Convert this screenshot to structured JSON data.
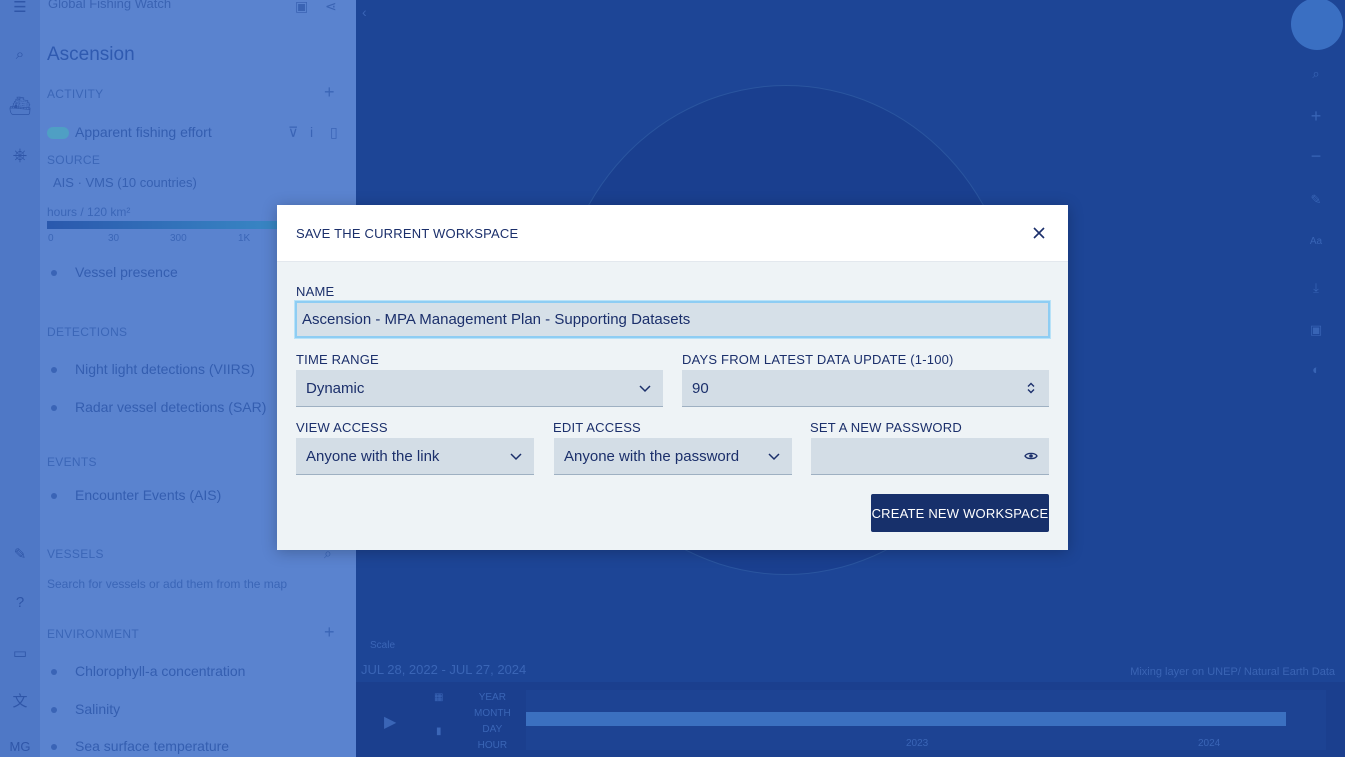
{
  "sidebar": {
    "app_name": "Global Fishing Watch",
    "app_tagline": "",
    "workspace_title": "Ascension",
    "activity": {
      "heading": "ACTIVITY",
      "layer1": "Apparent fishing effort",
      "source_heading": "SOURCE",
      "sources": "AIS · VMS (10 countries)",
      "units": "hours / 120 km²",
      "scale_ticks": [
        "0",
        "30",
        "300",
        "1K"
      ],
      "layer2": "Vessel presence"
    },
    "detections": {
      "heading": "DETECTIONS",
      "layer1": "Night light detections (VIIRS)",
      "layer2": "Radar vessel detections (SAR)"
    },
    "events": {
      "heading": "EVENTS",
      "layer1": "Encounter Events (AIS)"
    },
    "vessels": {
      "heading": "VESSELS",
      "hint": "Search for vessels or add them from the map"
    },
    "environment": {
      "heading": "ENVIRONMENT",
      "layer1": "Chlorophyll-a concentration",
      "layer2": "Salinity",
      "layer3": "Sea surface temperature"
    },
    "user_initials": "MG"
  },
  "map": {
    "time_range_label": "JUL 28, 2022 - JUL 27, 2024",
    "time_small_label": "Scale",
    "resolutions": [
      "YEAR",
      "MONTH",
      "DAY",
      "HOUR"
    ],
    "years": [
      "2023",
      "2024"
    ],
    "attribution": "Mixing layer on UNEP/ Natural Earth Data"
  },
  "modal": {
    "title": "SAVE THE CURRENT WORKSPACE",
    "name": {
      "label": "NAME",
      "value": "Ascension - MPA Management Plan - Supporting Datasets"
    },
    "time_range": {
      "label": "TIME RANGE",
      "value": "Dynamic"
    },
    "days": {
      "label": "DAYS FROM LATEST DATA UPDATE (1-100)",
      "value": "90"
    },
    "view_access": {
      "label": "VIEW ACCESS",
      "value": "Anyone with the link"
    },
    "edit_access": {
      "label": "EDIT ACCESS",
      "value": "Anyone with the password"
    },
    "password": {
      "label": "SET A NEW PASSWORD",
      "value": ""
    },
    "create_button": "CREATE NEW WORKSPACE"
  },
  "colors": {
    "primary": "#17306b",
    "overlay": "#163b8c",
    "focus_ring": "#8ecdf3"
  }
}
